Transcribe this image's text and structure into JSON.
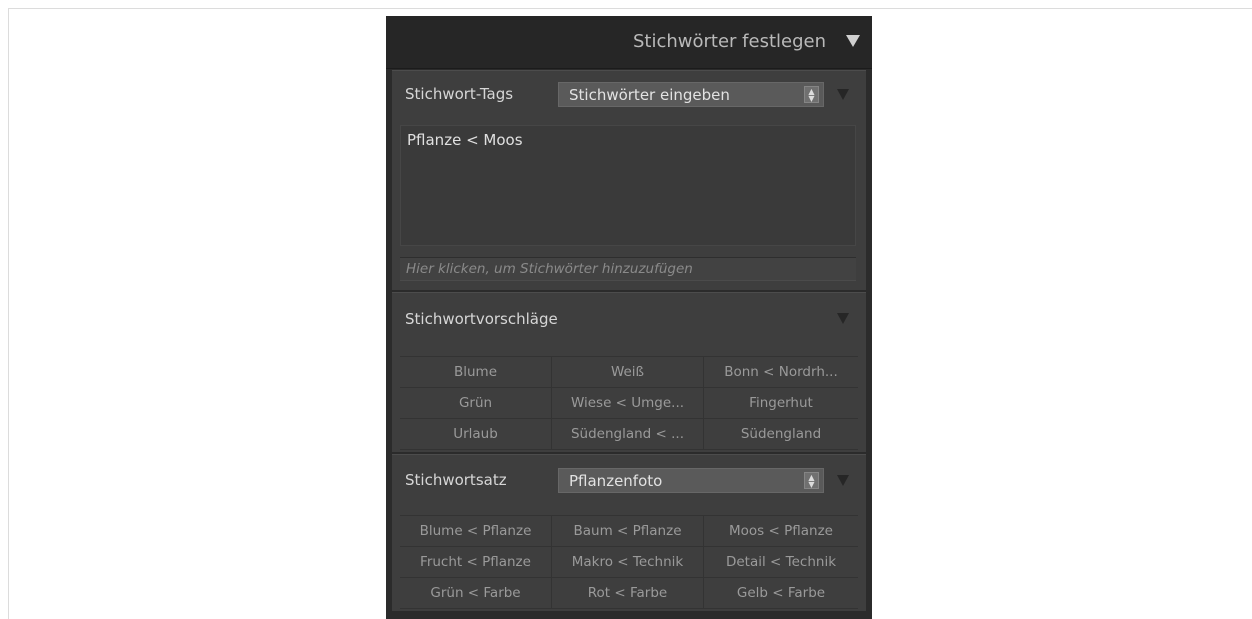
{
  "header": {
    "title": "Stichwörter festlegen"
  },
  "keyword_tags": {
    "label": "Stichwort-Tags",
    "mode_value": "Stichwörter eingeben",
    "tags_text": "Pflanze < Moos",
    "hint": "Hier klicken, um Stichwörter hinzuzufügen"
  },
  "suggestions": {
    "title": "Stichwortvorschläge",
    "rows": [
      [
        "Blume",
        "Weiß",
        "Bonn < Nordrh..."
      ],
      [
        "Grün",
        "Wiese < Umge...",
        "Fingerhut"
      ],
      [
        "Urlaub",
        "Südengland < ...",
        "Südengland"
      ]
    ]
  },
  "keyword_set": {
    "label": "Stichwortsatz",
    "set_value": "Pflanzenfoto",
    "rows": [
      [
        "Blume < Pflanze",
        "Baum < Pflanze",
        "Moos < Pflanze"
      ],
      [
        "Frucht < Pflanze",
        "Makro < Technik",
        "Detail < Technik"
      ],
      [
        "Grün < Farbe",
        "Rot < Farbe",
        "Gelb < Farbe"
      ]
    ]
  },
  "colors": {
    "panel_bg": "#2b2b2b",
    "section_bg": "#3e3e3e",
    "text_primary": "#d6d6d6",
    "text_muted": "#9a9a9a"
  },
  "icons": [
    "collapse-triangle-icon",
    "spinner-arrows-icon"
  ]
}
